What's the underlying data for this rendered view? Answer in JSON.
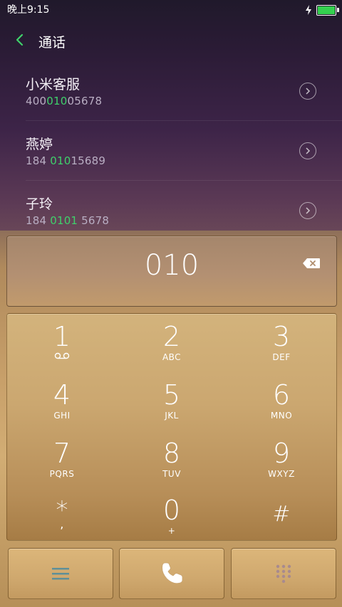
{
  "status": {
    "time": "晚上9:15",
    "battery_color": "#34d14f"
  },
  "header": {
    "title": "通话",
    "back_icon": "chevron-left-icon",
    "accent": "#3fd16b"
  },
  "list": [
    {
      "name": "小米客服",
      "number_pre": "400",
      "number_hl": "010",
      "number_post": "05678"
    },
    {
      "name": "燕婷",
      "number_pre": "184 ",
      "number_hl": "010",
      "number_post": "15689"
    },
    {
      "name": "子玲",
      "number_pre": "184 ",
      "number_hl": "0101",
      "number_post": " 5678"
    }
  ],
  "dialer": {
    "entered": "010",
    "keys": [
      {
        "digit": "1",
        "letters": ""
      },
      {
        "digit": "2",
        "letters": "ABC"
      },
      {
        "digit": "3",
        "letters": "DEF"
      },
      {
        "digit": "4",
        "letters": "GHI"
      },
      {
        "digit": "5",
        "letters": "JKL"
      },
      {
        "digit": "6",
        "letters": "MNO"
      },
      {
        "digit": "7",
        "letters": "PQRS"
      },
      {
        "digit": "8",
        "letters": "TUV"
      },
      {
        "digit": "9",
        "letters": "WXYZ"
      },
      {
        "digit": "*",
        "letters": ","
      },
      {
        "digit": "0",
        "letters": "+"
      },
      {
        "digit": "#",
        "letters": ""
      }
    ]
  },
  "bottom": {
    "menu_icon": "menu-icon",
    "call_icon": "phone-icon",
    "keypad_icon": "dialpad-icon"
  }
}
